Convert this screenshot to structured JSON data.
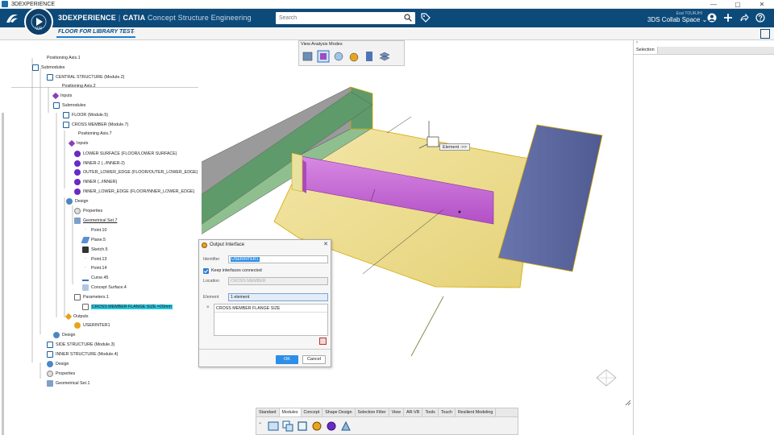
{
  "os": {
    "title": "3DEXPERIENCE",
    "min": "—",
    "max": "▢",
    "close": "✕"
  },
  "header": {
    "brand": "3DEXPERIENCE",
    "sep": "|",
    "app": "CATIA",
    "role": "Concept Structure Engineering",
    "compass_version": "V,R",
    "search_placeholder": "Search",
    "user_name": "Essi TOURJHI",
    "space": "3DS Collab Space",
    "space_chevron": "⌄"
  },
  "tabs": {
    "active": "FLOOR FOR LIBRARY TEST",
    "add": "+"
  },
  "tree": {
    "nodes": [
      {
        "label": "Positioning Axis.1",
        "icon": "axis"
      },
      {
        "label": "Submodules",
        "icon": "mod"
      },
      {
        "label": "CENTRAL STRUCTURE (Module.2)",
        "icon": "mod"
      },
      {
        "label": "Positioning Axis.2",
        "icon": "axis"
      },
      {
        "label": "Inputs",
        "icon": "inp"
      },
      {
        "label": "Submodules",
        "icon": "mod"
      },
      {
        "label": "FLOOR (Module.5)",
        "icon": "mod"
      },
      {
        "label": "CROSS MEMBER (Module.7)",
        "icon": "mod"
      },
      {
        "label": "Positioning Axis.7",
        "icon": "axis"
      },
      {
        "label": "Inputs",
        "icon": "inp"
      },
      {
        "label": "LOWER SURFACE (FLOOR/LOWER SURFACE)",
        "icon": "face"
      },
      {
        "label": "INNER-2 (../INNER-2)",
        "icon": "face"
      },
      {
        "label": "OUTER_LOWER_EDGE (FLOOR/OUTER_LOWER_EDGE)",
        "icon": "face"
      },
      {
        "label": "INNER (../INNER)",
        "icon": "face"
      },
      {
        "label": "INNER_LOWER_EDGE (FLOOR/INNER_LOWER_EDGE)",
        "icon": "face"
      },
      {
        "label": "Design",
        "icon": "design"
      },
      {
        "label": "Properties",
        "icon": "prop"
      },
      {
        "label": "Geometrical Set.7",
        "icon": "geo"
      },
      {
        "label": "Point.10",
        "icon": "pt"
      },
      {
        "label": "Plane.5",
        "icon": "plane"
      },
      {
        "label": "Sketch.5",
        "icon": "sketch"
      },
      {
        "label": "Point.13",
        "icon": "pt"
      },
      {
        "label": "Point.14",
        "icon": "pt"
      },
      {
        "label": "Curve.45",
        "icon": "curve"
      },
      {
        "label": "Concept Surface.4",
        "icon": "surf"
      },
      {
        "label": "Parameters.1",
        "icon": "param"
      },
      {
        "label": "CROSS MEMBER FLANGE SIZE =20mm",
        "icon": "param"
      },
      {
        "label": "Outputs",
        "icon": "out"
      },
      {
        "label": "USERINTER1",
        "icon": "user"
      },
      {
        "label": "Design",
        "icon": "design"
      },
      {
        "label": "SIDE STRUCTURE (Module.3)",
        "icon": "mod"
      },
      {
        "label": "INNER STRUCTURE (Module.4)",
        "icon": "mod"
      },
      {
        "label": "Design",
        "icon": "design"
      },
      {
        "label": "Properties",
        "icon": "prop"
      },
      {
        "label": "Geometrical Set.1",
        "icon": "geo"
      }
    ]
  },
  "view_analysis": {
    "title": "View Analysis Modes"
  },
  "element_tip": "Element ->>",
  "dialog": {
    "title": "Output Interface",
    "identifier_label": "Identifier",
    "identifier_value": "USERINTER1",
    "keep_label": "Keep interfaces connected",
    "keep_checked": true,
    "location_label": "Location",
    "location_value": "CROSS MEMBER",
    "element_label": "Element",
    "element_value": "1 element",
    "list_items": [
      "CROSS MEMBER FLANGE SIZE"
    ],
    "ok": "OK",
    "cancel": "Cancel"
  },
  "right_panel": {
    "chevron": "›",
    "tab": "Selection"
  },
  "action_bar": {
    "tabs": [
      "Standard",
      "Modules",
      "Concept",
      "Shape Design",
      "Selection Filter",
      "View",
      "AR-VR",
      "Tools",
      "Touch",
      "Resilient Modeling"
    ],
    "active": "Modules"
  },
  "colors": {
    "header_bg": "#0c4a7a",
    "accent": "#2c8ee8",
    "floor_yellow": "#eddc8a",
    "beam_green": "#5f9a6a",
    "cross_member_magenta": "#c55ad6",
    "side_panel_blue": "#5e6aa2"
  }
}
